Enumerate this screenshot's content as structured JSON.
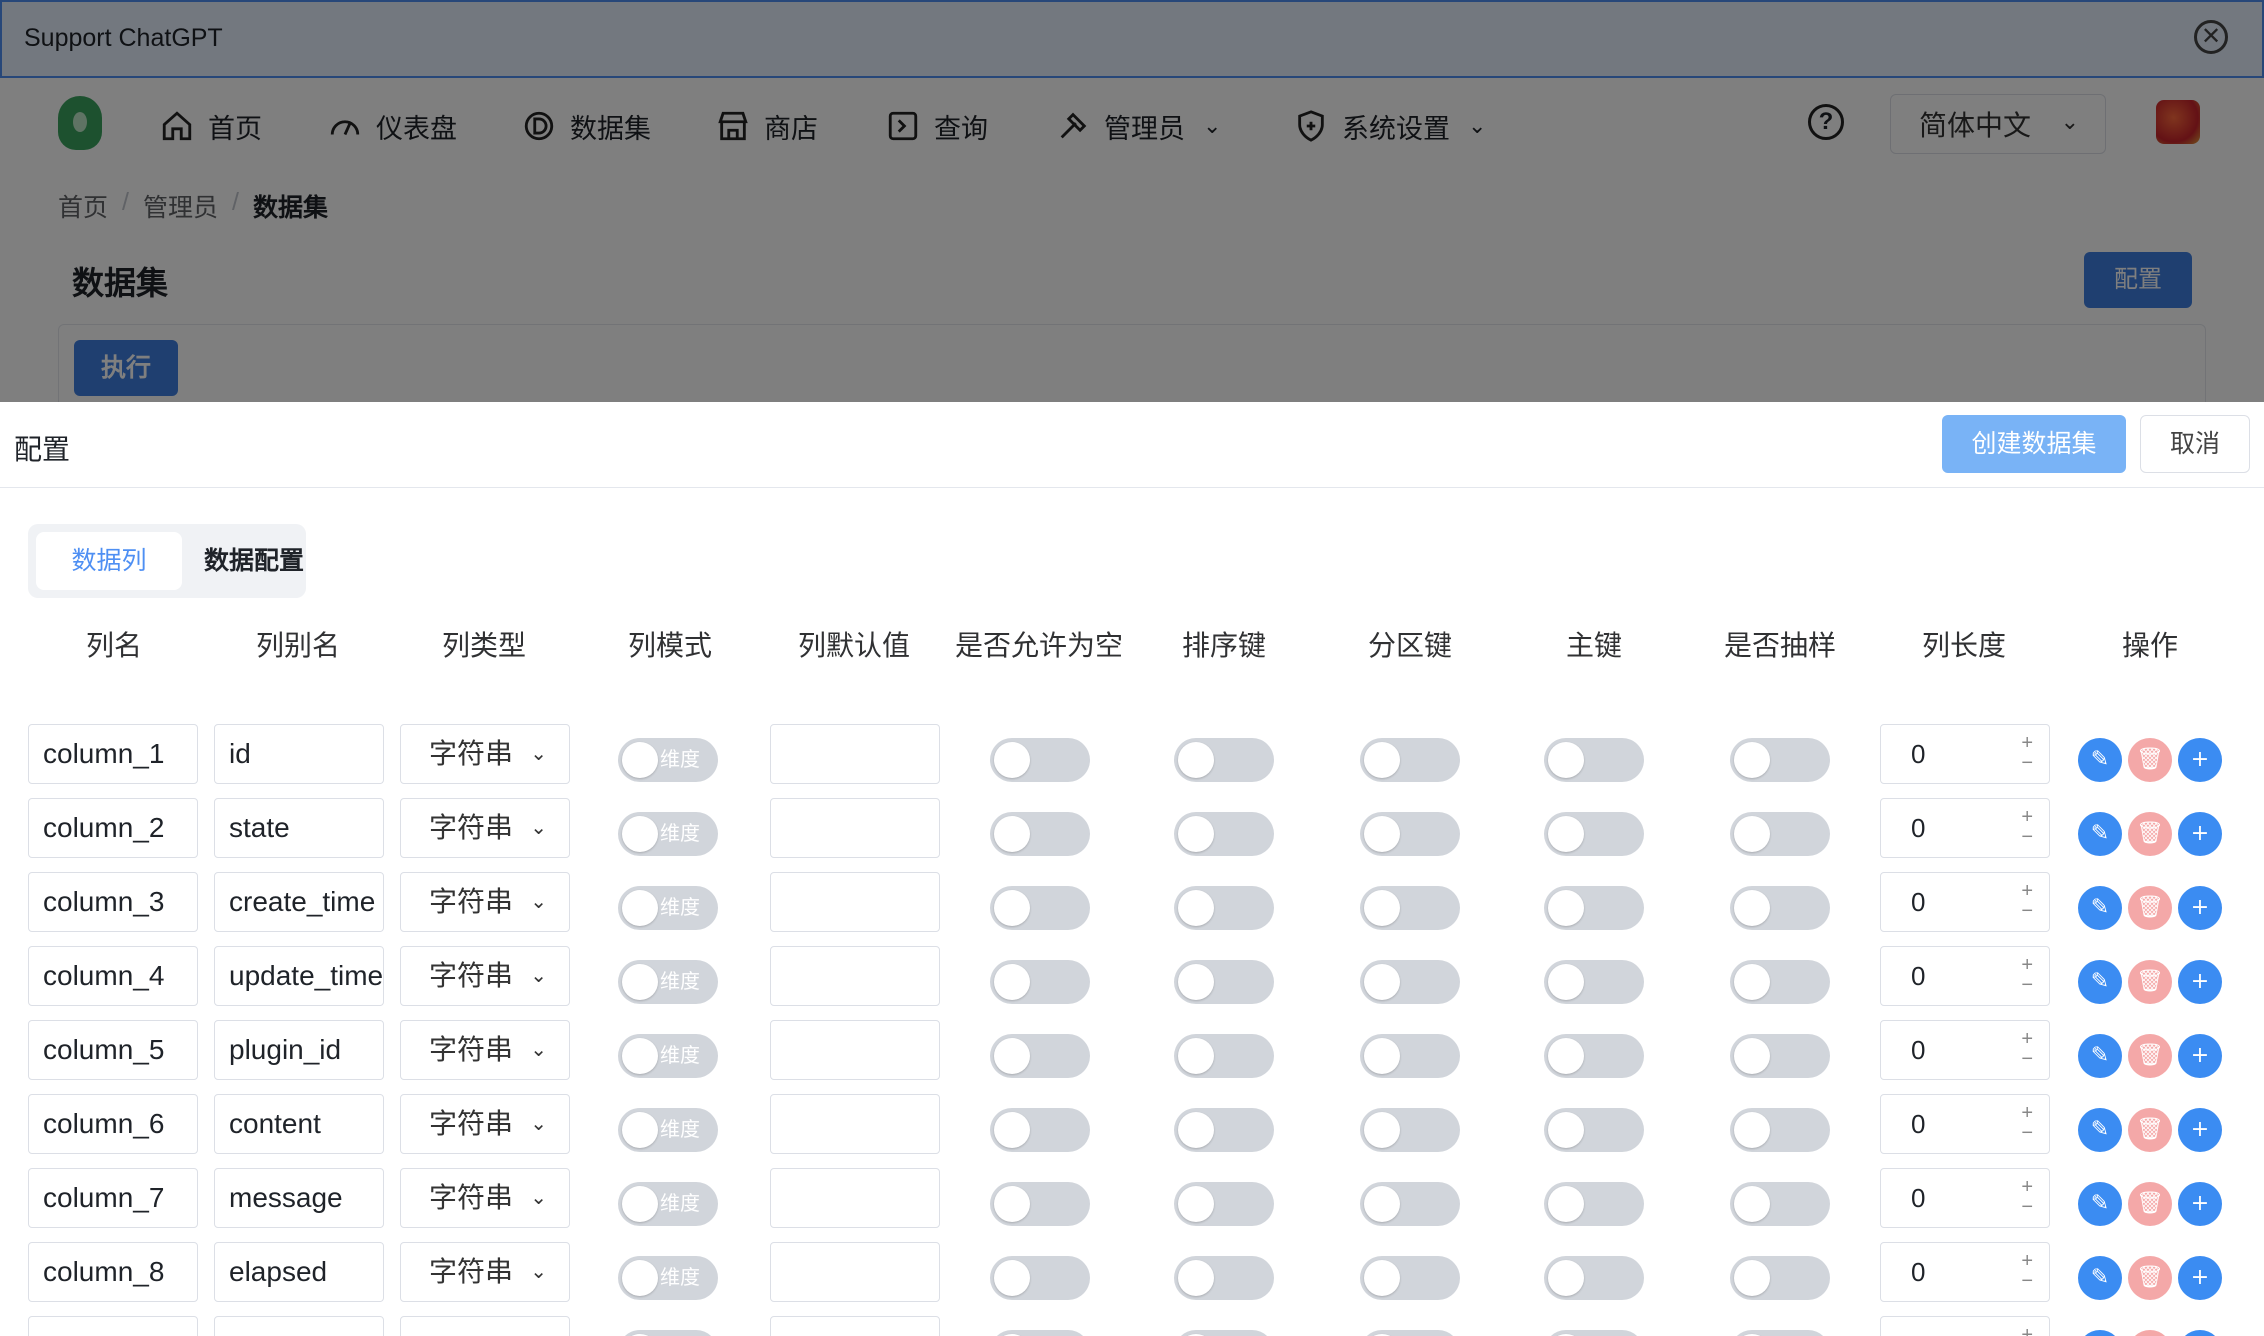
{
  "support_bar": {
    "title": "Support ChatGPT",
    "close_glyph": "✕"
  },
  "nav": {
    "items": [
      {
        "label": "首页",
        "icon": "home-icon"
      },
      {
        "label": "仪表盘",
        "icon": "gauge-icon"
      },
      {
        "label": "数据集",
        "icon": "dataset-icon"
      },
      {
        "label": "商店",
        "icon": "store-icon"
      },
      {
        "label": "查询",
        "icon": "terminal-icon"
      },
      {
        "label": "管理员",
        "icon": "hammer-icon"
      },
      {
        "label": "系统设置",
        "icon": "shield-icon"
      }
    ],
    "help_glyph": "?",
    "language": "简体中文",
    "chevron": "⌄"
  },
  "breadcrumb": {
    "home": "首页",
    "admin": "管理员",
    "current": "数据集",
    "separator": "/"
  },
  "page": {
    "title": "数据集",
    "config_button": "配置",
    "execute_button": "执行"
  },
  "drawer": {
    "title": "配置",
    "create_button": "创建数据集",
    "cancel_button": "取消",
    "tabs": {
      "columns": "数据列",
      "config": "数据配置"
    },
    "headers": [
      "列名",
      "列别名",
      "列类型",
      "列模式",
      "列默认值",
      "是否允许为空",
      "排序键",
      "分区键",
      "主键",
      "是否抽样",
      "列长度",
      "操作"
    ],
    "mode_label": "维度",
    "type_label": "字符串",
    "rows": [
      {
        "name": "column_1",
        "alias": "id",
        "type": "字符串",
        "length": "0"
      },
      {
        "name": "column_2",
        "alias": "state",
        "type": "字符串",
        "length": "0"
      },
      {
        "name": "column_3",
        "alias": "create_time",
        "type": "字符串",
        "length": "0"
      },
      {
        "name": "column_4",
        "alias": "update_time",
        "type": "字符串",
        "length": "0"
      },
      {
        "name": "column_5",
        "alias": "plugin_id",
        "type": "字符串",
        "length": "0"
      },
      {
        "name": "column_6",
        "alias": "content",
        "type": "字符串",
        "length": "0"
      },
      {
        "name": "column_7",
        "alias": "message",
        "type": "字符串",
        "length": "0"
      },
      {
        "name": "column_8",
        "alias": "elapsed",
        "type": "字符串",
        "length": "0"
      },
      {
        "name": "",
        "alias": "",
        "type": "",
        "length": ""
      }
    ],
    "stepper": {
      "plus": "+",
      "minus": "−"
    },
    "actions": {
      "edit": "✎",
      "delete": "🗑",
      "add": "+"
    }
  }
}
